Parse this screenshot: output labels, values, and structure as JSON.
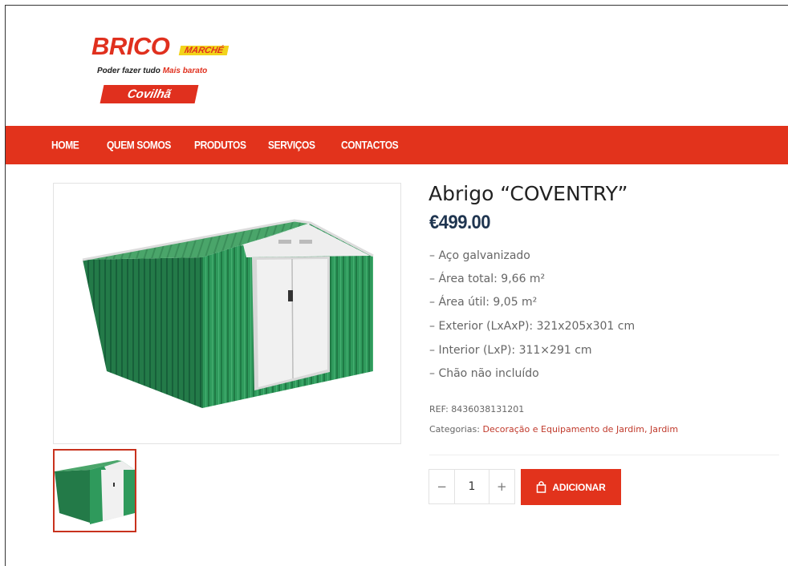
{
  "logo": {
    "brand": "BRICO",
    "sub": "MARCHÉ",
    "tagline_a": "Poder fazer tudo ",
    "tagline_b": "Mais barato",
    "city": "Covilhã"
  },
  "nav": {
    "items": [
      "HOME",
      "QUEM SOMOS",
      "PRODUTOS",
      "SERVIÇOS",
      "CONTACTOS"
    ]
  },
  "product": {
    "title": "Abrigo “COVENTRY”",
    "price": "€499.00",
    "features": [
      "– Aço galvanizado",
      "– Área total: 9,66 m²",
      "– Área útil: 9,05 m²",
      "– Exterior (LxAxP): 321x205x301 cm",
      "– Interior (LxP): 311×291 cm",
      "– Chão não incluído"
    ],
    "ref_label": "REF: ",
    "ref_value": "8436038131201",
    "categories_label": "Categorias: ",
    "categories_value": "Decoração e Equipamento de Jardim, Jardim",
    "quantity": "1",
    "add_label": "ADICIONAR"
  },
  "colors": {
    "brand_red": "#e2331c",
    "price_navy": "#1f3550",
    "shed_green": "#2f9a5c"
  }
}
